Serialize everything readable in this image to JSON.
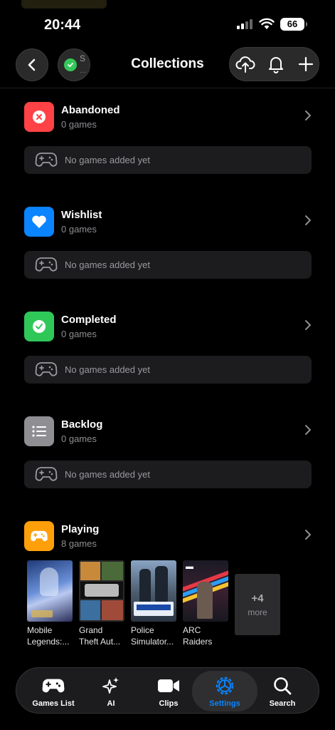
{
  "status_bar": {
    "time": "20:44",
    "battery": "66"
  },
  "header": {
    "title": "Collections",
    "profile_initial": "S",
    "profile_sub": "..."
  },
  "collections": [
    {
      "name": "Abandoned",
      "count": "0 games",
      "empty_text": "No games added yet",
      "color": "#ff3b30",
      "icon": "x-circle-icon"
    },
    {
      "name": "Wishlist",
      "count": "0 games",
      "empty_text": "No games added yet",
      "color": "#0a84ff",
      "icon": "heart-icon"
    },
    {
      "name": "Completed",
      "count": "0 games",
      "empty_text": "No games added yet",
      "color": "#30d158",
      "icon": "check-circle-icon"
    },
    {
      "name": "Backlog",
      "count": "0 games",
      "empty_text": "No games added yet",
      "color": "#8e8e93",
      "icon": "list-icon"
    },
    {
      "name": "Playing",
      "count": "8 games",
      "color": "#ff9f0a",
      "icon": "gamepad-icon"
    }
  ],
  "playing_games": [
    {
      "line1": "Mobile",
      "line2": "Legends:..."
    },
    {
      "line1": "Grand",
      "line2": "Theft Aut..."
    },
    {
      "line1": "Police",
      "line2": "Simulator..."
    },
    {
      "line1": "ARC",
      "line2": "Raiders"
    }
  ],
  "more": {
    "count": "+4",
    "label": "more"
  },
  "tabs": [
    {
      "label": "Games List",
      "icon": "gamepad-icon"
    },
    {
      "label": "AI",
      "icon": "sparkles-icon"
    },
    {
      "label": "Clips",
      "icon": "video-camera-icon"
    },
    {
      "label": "Settings",
      "icon": "gear-icon",
      "active": true
    },
    {
      "label": "Search",
      "icon": "search-icon"
    }
  ]
}
